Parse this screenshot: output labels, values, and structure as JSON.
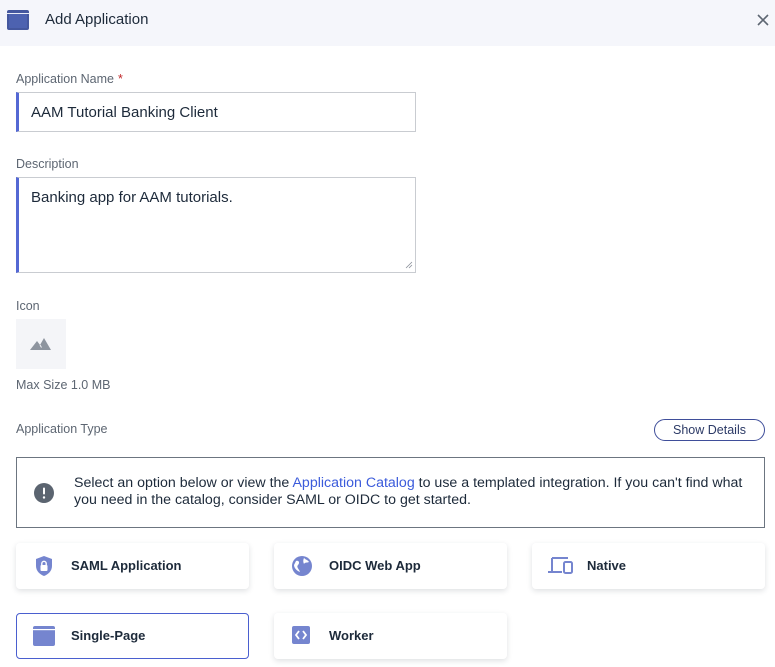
{
  "dialog": {
    "title": "Add Application",
    "title_icon": "browser-window-icon",
    "close_icon": "close-icon"
  },
  "form": {
    "name": {
      "label": "Application Name",
      "required_marker": "*",
      "value": "AAM Tutorial Banking Client"
    },
    "description": {
      "label": "Description",
      "value": "Banking app for AAM tutorials."
    },
    "icon": {
      "label": "Icon",
      "placeholder_icon": "image-placeholder-icon",
      "hint": "Max Size 1.0 MB"
    },
    "application_type": {
      "label": "Application Type",
      "show_details_label": "Show Details",
      "notice": {
        "icon": "alert-circle-icon",
        "text_before": "Select an option below or view the ",
        "link_text": "Application Catalog",
        "text_after": " to use a templated integration. If you can't find what you need in the catalog, consider SAML or OIDC to get started."
      },
      "options": [
        {
          "label": "SAML Application",
          "icon": "shield-lock-icon",
          "selected": false
        },
        {
          "label": "OIDC Web App",
          "icon": "globe-icon",
          "selected": false
        },
        {
          "label": "Native",
          "icon": "devices-icon",
          "selected": false
        },
        {
          "label": "Single-Page",
          "icon": "browser-window-icon",
          "selected": true
        },
        {
          "label": "Worker",
          "icon": "code-icon",
          "selected": false
        }
      ]
    }
  },
  "colors": {
    "accent": "#5468d4",
    "icon_accent": "#7585cf",
    "link": "#3b5bdb",
    "required": "#c0282a"
  }
}
